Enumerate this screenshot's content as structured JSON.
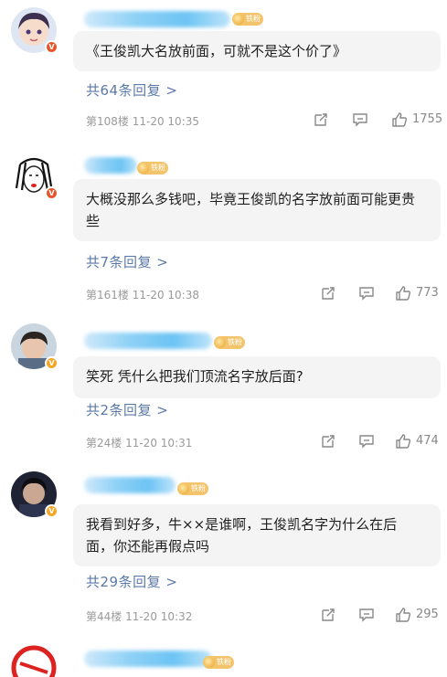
{
  "comments": [
    {
      "badge": "铁粉",
      "text": "《王俊凯大名放前面，可就不是这个价了》",
      "replies": "共64条回复 >",
      "meta": "第108楼 11-20 10:35",
      "likes": "1755"
    },
    {
      "badge": "铁粉",
      "text": "大概没那么多钱吧，毕竟王俊凯的名字放前面可能更贵些",
      "replies": "共7条回复 >",
      "meta": "第161楼 11-20 10:38",
      "likes": "773"
    },
    {
      "badge": "铁粉",
      "text": "笑死 凭什么把我们顶流名字放后面?",
      "replies": "共2条回复 >",
      "meta": "第24楼 11-20 10:31",
      "likes": "474"
    },
    {
      "badge": "铁粉",
      "text": "我看到好多，牛××是谁啊，王俊凯名字为什么在后面，你还能再假点吗",
      "replies": "共29条回复 >",
      "meta": "第44楼 11-20 10:32",
      "likes": "295"
    },
    {
      "badge": "铁粉"
    }
  ],
  "colors": {
    "reply_link": "#5b7aa8",
    "bubble_bg": "#f4f4f4",
    "badge_bg": "#f3c46b"
  },
  "icons": [
    "share-icon",
    "comment-icon",
    "like-icon"
  ]
}
